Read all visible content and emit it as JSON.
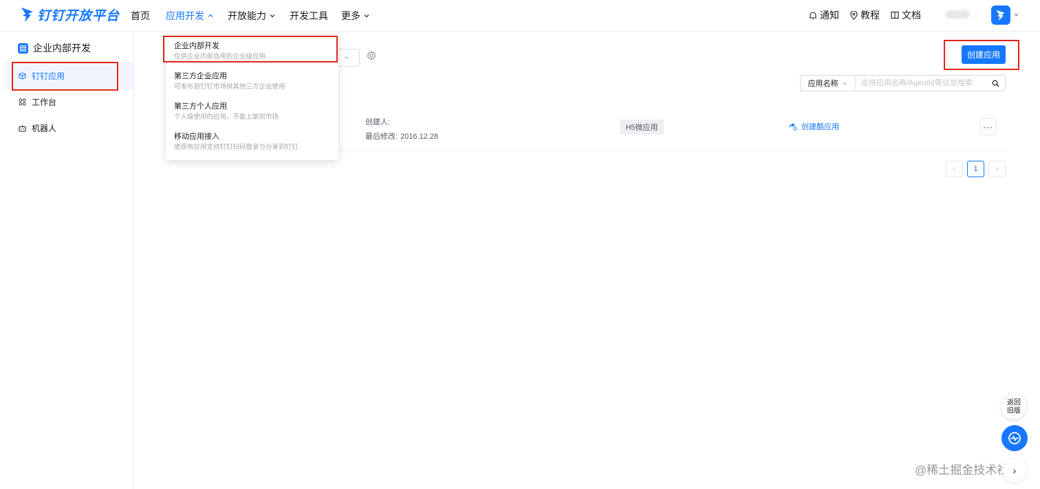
{
  "header": {
    "logo_text": "钉钉开放平台",
    "nav": [
      {
        "label": "首页"
      },
      {
        "label": "应用开发"
      },
      {
        "label": "开放能力"
      },
      {
        "label": "开发工具"
      },
      {
        "label": "更多"
      }
    ],
    "right_links": [
      {
        "label": "通知",
        "icon": "bell-icon"
      },
      {
        "label": "教程",
        "icon": "location-pin-icon"
      },
      {
        "label": "文档",
        "icon": "book-icon"
      }
    ],
    "username": "Mob"
  },
  "sidebar": {
    "title": "企业内部开发",
    "items": [
      {
        "label": "钉钉应用",
        "icon": "cube-icon",
        "active": true
      },
      {
        "label": "工作台",
        "icon": "grid-icon",
        "active": false
      },
      {
        "label": "机器人",
        "icon": "robot-icon",
        "active": false
      }
    ]
  },
  "toolbar": {
    "create_label": "创建应用",
    "search_type": "应用名称",
    "search_placeholder": "支持应用名称/AgentId等信息搜索"
  },
  "app_row": {
    "creator_label": "创建人:",
    "modified_label": "最后修改:",
    "modified_date": "2016.12.28",
    "tag": "H5微应用",
    "cool_app_link": "创建酷应用",
    "more_label": "···"
  },
  "pagination": {
    "prev": "‹",
    "current_page": "1",
    "next": "›"
  },
  "dropdown": {
    "items": [
      {
        "title": "企业内部开发",
        "desc": "仅供企业内部自用的企业级应用"
      },
      {
        "title": "第三方企业应用",
        "desc": "可发布到钉钉市场供其他三方企业使用"
      },
      {
        "title": "第三方个人应用",
        "desc": "个人级使用的应用，不能上架到市场"
      },
      {
        "title": "移动应用接入",
        "desc": "使现有应用支持钉钉扫码登录与分享到钉钉"
      }
    ]
  },
  "floating": {
    "old_version_line1": "返回",
    "old_version_line2": "旧版",
    "next_symbol": "›"
  },
  "watermark": "@稀土掘金技术社区",
  "colors": {
    "accent": "#1677ff",
    "annotation_red": "#e2231a"
  }
}
